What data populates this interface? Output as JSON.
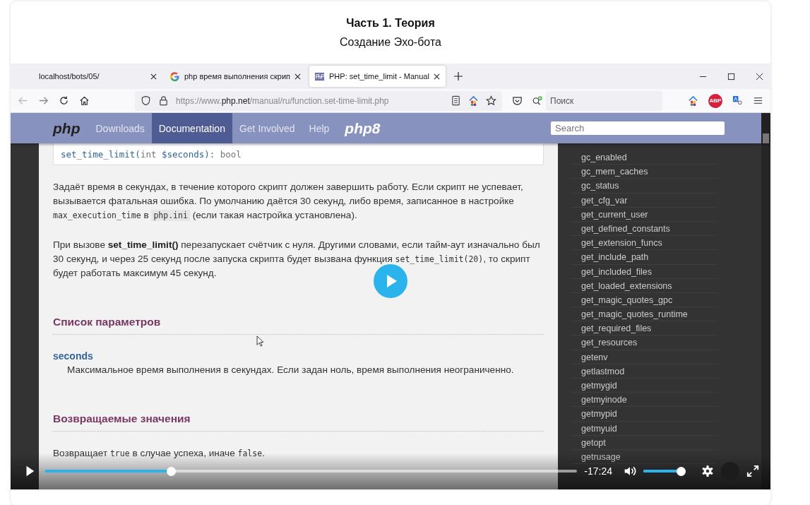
{
  "header": {
    "title": "Часть 1. Теория",
    "subtitle": "Создание Эхо-бота"
  },
  "browser": {
    "tabs": [
      {
        "title": "localhost/bots/05/",
        "kind": "local",
        "selected": false
      },
      {
        "title": "php время выполнения скрип",
        "kind": "search",
        "selected": false
      },
      {
        "title": "PHP: set_time_limit - Manual",
        "kind": "doc",
        "selected": true
      }
    ],
    "address": [
      {
        "text": "https://www.",
        "kind": "dim"
      },
      {
        "text": "php.net",
        "kind": "host"
      },
      {
        "text": "/manual/ru/function.set-time-limit.php",
        "kind": "dim"
      }
    ],
    "search_placeholder": "Поиск",
    "adblock_label": "ABP"
  },
  "site": {
    "logo": "php",
    "nav": [
      {
        "label": "Downloads",
        "selected": false
      },
      {
        "label": "Documentation",
        "selected": true
      },
      {
        "label": "Get Involved",
        "selected": false
      },
      {
        "label": "Help",
        "selected": false
      }
    ],
    "logo_version": "php8",
    "search_placeholder": "Search"
  },
  "doc": {
    "signature": [
      {
        "text": "set_time_limit(",
        "kind": "name"
      },
      {
        "text": "int ",
        "kind": "type"
      },
      {
        "text": "$seconds",
        "kind": "var"
      },
      {
        "text": "): ",
        "kind": "name"
      },
      {
        "text": "bool",
        "kind": "type"
      }
    ],
    "paragraphs": [
      [
        {
          "text": "Задаёт время в секундах, в течение которого скрипт должен завершить работу. Если скрипт не успевает, вызывается фатальная ошибка. По умолчанию даётся 30 секунд, либо время, записанное в настройке ",
          "kind": "plain"
        },
        {
          "text": "max_execution_time",
          "kind": "code"
        },
        {
          "text": " в ",
          "kind": "plain"
        },
        {
          "text": "php.ini",
          "kind": "file"
        },
        {
          "text": " (если такая настройка установлена).",
          "kind": "plain"
        }
      ],
      [
        {
          "text": "При вызове ",
          "kind": "plain"
        },
        {
          "text": "set_time_limit()",
          "kind": "bold"
        },
        {
          "text": " перезапускает счётчик с нуля. Другими словами, если тайм-аут изначально был 30 секунд, и через 25 секунд после запуска скрипта будет вызвана функция ",
          "kind": "plain"
        },
        {
          "text": "set_time_limit(20)",
          "kind": "code"
        },
        {
          "text": ", то скрипт будет работать максимум 45 секунд.",
          "kind": "plain"
        }
      ]
    ],
    "sections": [
      {
        "heading": "Список параметров",
        "term": "seconds",
        "text": [
          {
            "text": "Максимальное время выполнения в секундах. Если задан ноль, время выполнения неограниченно.",
            "kind": "plain"
          }
        ]
      },
      {
        "heading": "Возвращаемые значения",
        "text": [
          {
            "text": "Возвращает ",
            "kind": "plain"
          },
          {
            "text": "true",
            "kind": "code"
          },
          {
            "text": " в случае успеха, иначе ",
            "kind": "plain"
          },
          {
            "text": "false",
            "kind": "code"
          },
          {
            "text": ".",
            "kind": "plain"
          }
        ]
      }
    ]
  },
  "sidebar": [
    "gc_enabled",
    "gc_mem_caches",
    "gc_status",
    "get_cfg_var",
    "get_current_user",
    "get_defined_constants",
    "get_extension_funcs",
    "get_include_path",
    "get_included_files",
    "get_loaded_extensions",
    "get_magic_quotes_gpc",
    "get_magic_quotes_runtime",
    "get_required_files",
    "get_resources",
    "getenv",
    "getlastmod",
    "getmygid",
    "getmyinode",
    "getmypid",
    "getmyuid",
    "getopt",
    "getrusage"
  ],
  "player": {
    "paused": true,
    "progress": {
      "level": 0.233
    },
    "time": "-17:24",
    "volume": {
      "level": 1
    }
  }
}
